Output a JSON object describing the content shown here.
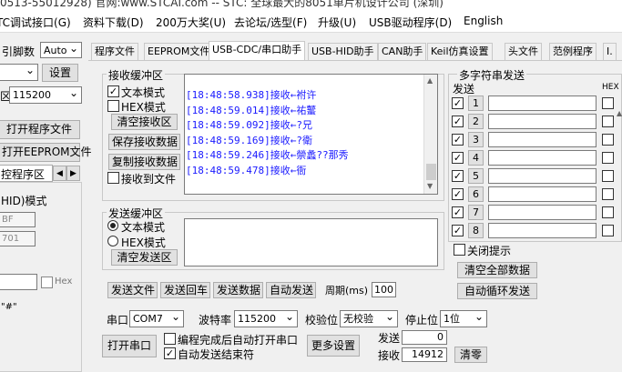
{
  "menu": [
    "TC调试接口(G)",
    "资料下载(D)",
    "200万大奖(U)",
    "去论坛/选型(F)",
    "升级(U)",
    "USB驱动程序(D)",
    "English"
  ],
  "title_text": "0513-55012928) 官网:www.STCAI.com -- STC: 全球最大的8051单片机设计公司 (深圳)",
  "left": {
    "pin_label": "引脚数",
    "pin_value": "Auto",
    "scan_btn": "设置",
    "baud_prefix": "区",
    "baud_value": "115200",
    "open_prog_btn": "打开程序文件",
    "open_eeprom_btn": "打开EEPROM文件",
    "prog_area_label": "控程序区",
    "hid_mode_label": "HID)模式",
    "field1": "BF",
    "field2": "701",
    "hex_label": "Hex",
    "quote_text": "\"#\""
  },
  "tabs": [
    "程序文件",
    "EEPROM文件",
    "USB-CDC/串口助手",
    "USB-HID助手",
    "CAN助手",
    "Keil仿真设置",
    "头文件",
    "范例程序",
    "I."
  ],
  "recv": {
    "title": "接收缓冲区",
    "text_mode": "文本模式",
    "hex_mode": "HEX模式",
    "clear_btn": "清空接收区",
    "save_btn": "保存接收数据",
    "copy_btn": "复制接收数据",
    "to_file": "接收到文件",
    "lines": [
      "[18:48:58.938]接收←祔许",
      "[18:48:59.014]接收←祐鼜",
      "[18:48:59.092]接收←?兄",
      "[18:48:59.169]接收←?衛",
      "[18:48:59.246]接收←禜蠡??那秀",
      "[18:48:59.478]接收←衙"
    ]
  },
  "send": {
    "title": "发送缓冲区",
    "text_mode": "文本模式",
    "hex_mode": "HEX模式",
    "clear_btn": "清空发送区",
    "btn_file": "发送文件",
    "btn_return": "发送回车",
    "btn_data": "发送数据",
    "btn_auto": "自动发送",
    "period_label": "周期(ms)",
    "period_value": "100"
  },
  "multi": {
    "title": "多字符串发送",
    "send_col": "发送",
    "hex_col": "HEX",
    "rows": [
      "1",
      "2",
      "3",
      "4",
      "5",
      "6",
      "7",
      "8"
    ],
    "close_tip": "关闭提示",
    "clear_all": "清空全部数据",
    "auto_loop": "自动循环发送"
  },
  "bottom": {
    "port_label": "串口",
    "port_value": "COM7",
    "baud_label": "波特率",
    "baud_value": "115200",
    "parity_label": "校验位",
    "parity_value": "无校验",
    "stop_label": "停止位",
    "stop_value": "1位",
    "open_btn": "打开串口",
    "auto_open": "编程完成后自动打开串口",
    "auto_end": "自动发送结束符",
    "more_btn": "更多设置",
    "send_label": "发送",
    "send_count": "0",
    "recv_label": "接收",
    "recv_count": "14912",
    "clear_btn": "清零"
  }
}
